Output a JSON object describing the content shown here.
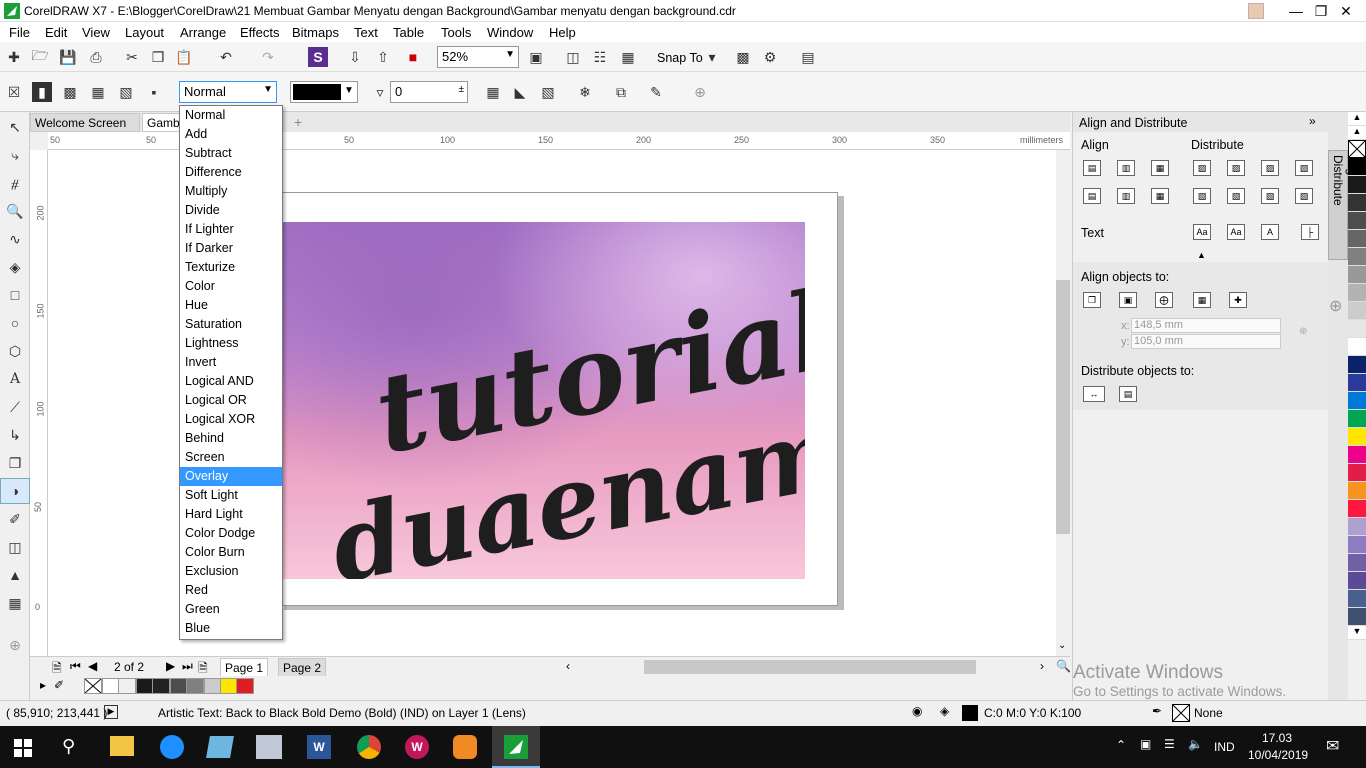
{
  "window": {
    "title": "CorelDRAW X7 - E:\\Blogger\\CorelDraw\\21 Membuat Gambar Menyatu dengan Background\\Gambar menyatu dengan background.cdr"
  },
  "menu": [
    "File",
    "Edit",
    "View",
    "Layout",
    "Arrange",
    "Effects",
    "Bitmaps",
    "Text",
    "Table",
    "Tools",
    "Window",
    "Help"
  ],
  "toolbar": {
    "zoom": "52%",
    "snap_label": "Snap To"
  },
  "propbar": {
    "merge_mode": "Normal",
    "transparency_value": "0"
  },
  "tabs": {
    "welcome": "Welcome Screen",
    "doc": "Gamba"
  },
  "ruler": {
    "unit": "millimeters",
    "h_ticks": [
      "50",
      "0",
      "50",
      "100",
      "150",
      "200",
      "250",
      "300",
      "350"
    ],
    "v_ticks": [
      "200",
      "150",
      "100",
      "50",
      "0"
    ]
  },
  "artwork": {
    "line1": "tutorial",
    "line2": "duaenam"
  },
  "dropdown": {
    "selected": "Overlay",
    "options": [
      "Normal",
      "Add",
      "Subtract",
      "Difference",
      "Multiply",
      "Divide",
      "If Lighter",
      "If Darker",
      "Texturize",
      "Color",
      "Hue",
      "Saturation",
      "Lightness",
      "Invert",
      "Logical AND",
      "Logical OR",
      "Logical XOR",
      "Behind",
      "Screen",
      "Overlay",
      "Soft Light",
      "Hard Light",
      "Color Dodge",
      "Color Burn",
      "Exclusion",
      "Red",
      "Green",
      "Blue"
    ]
  },
  "pages": {
    "counter": "2 of 2",
    "page1": "Page 1",
    "page2": "Page 2"
  },
  "docker": {
    "title": "Align and Distribute",
    "align": "Align",
    "distribute": "Distribute",
    "text": "Text",
    "align_to": "Align objects to:",
    "x_label": "x:",
    "x_value": "148,5 mm",
    "y_label": "y:",
    "y_value": "105,0 mm",
    "distribute_to": "Distribute objects to:",
    "vertical_tab": "Align and Distribute"
  },
  "watermark": {
    "line1": "Activate Windows",
    "line2": "Go to Settings to activate Windows."
  },
  "status": {
    "coords": "( 85,910; 213,441 )",
    "info": "Artistic Text: Back to Black Bold Demo (Bold) (IND) on Layer 1  (Lens)",
    "fill": "C:0 M:0 Y:0 K:100",
    "outline": "None"
  },
  "taskbar": {
    "lang": "IND",
    "time": "17.03",
    "date": "10/04/2019"
  },
  "colors": {
    "accent": "#3399ff",
    "palette": [
      "#000000",
      "#1a1a1a",
      "#333333",
      "#4d4d4d",
      "#666666",
      "#808080",
      "#999999",
      "#b3b3b3",
      "#cccccc",
      "#e6e6e6",
      "#ffffff",
      "#0a246a",
      "#2b3a9a",
      "#0078d7",
      "#00a651",
      "#ffe600",
      "#ec008c",
      "#e11d48",
      "#f7941d",
      "#ff1744",
      "#b0a0d0",
      "#8e7cc3",
      "#7060a8",
      "#5c4a96",
      "#486090",
      "#405070"
    ]
  }
}
